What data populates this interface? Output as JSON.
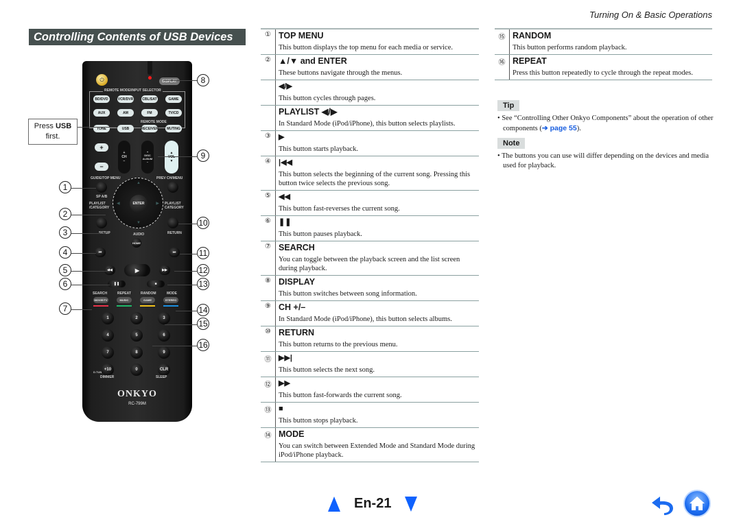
{
  "running_head": "Turning On & Basic Operations",
  "section_title": "Controlling Contents of USB Devices",
  "callout": {
    "prefix": "Press ",
    "bold": "USB",
    "suffix": "first."
  },
  "remote": {
    "brand": "ONKYO",
    "model": "RC-799M",
    "labels": {
      "display": "DISPLAY",
      "selector_group": "REMOTE MODE/INPUT SELECTOR",
      "remote_mode": "REMOTE MODE",
      "guide": "GUIDE/TOP MENU",
      "prev": "PREV CH/MENU",
      "sp": "SP A/B",
      "playlist_l": "PLAYLIST /CATEGORY",
      "playlist_r": "PLAYLIST CATEGORY",
      "setup": "SETUP",
      "return": "RETURN",
      "audio": "AUDIO",
      "home": "HOME",
      "ch": "CH",
      "disc": "DISC",
      "album": "ALBUM",
      "vol": "VOL",
      "enter": "ENTER",
      "search": "SEARCH",
      "repeat": "REPEAT",
      "random": "RANDOM",
      "mode": "MODE",
      "dtun": "D.TUN",
      "dimmer": "DIMMER",
      "sleep": "SLEEP"
    },
    "input_buttons": [
      "BD/DVD",
      "VCR/DVR",
      "CBL/SAT",
      "GAME",
      "AUX",
      "AM",
      "FM",
      "TV/CD",
      "TONE",
      "USB",
      "RECEIVER",
      "MUTING"
    ],
    "mode_buttons": [
      "MOVIE/TV",
      "MUSIC",
      "GAME",
      "STEREO"
    ],
    "mode_colors": [
      "#e8334a",
      "#1fb86a",
      "#f2c21b",
      "#1b8fe0"
    ],
    "number_buttons": [
      "1",
      "2",
      "3",
      "4",
      "5",
      "6",
      "7",
      "8",
      "9",
      "+10",
      "0",
      "CLR"
    ],
    "transport": {
      "prev": "⏮",
      "next": "⏭",
      "rew": "◀◀",
      "play": "▶",
      "ff": "▶▶",
      "pause": "❚❚",
      "stop": "■"
    }
  },
  "callout_numbers": [
    "①",
    "②",
    "③",
    "④",
    "⑤",
    "⑥",
    "⑦",
    "⑧",
    "⑨",
    "⑩",
    "⑪",
    "⑫",
    "⑬",
    "⑭",
    "⑮",
    "⑯"
  ],
  "middle_table": [
    {
      "num": "①",
      "head": "TOP MENU",
      "desc": "This button displays the top menu for each media or service."
    },
    {
      "num": "②",
      "head": "▲/▼ and ENTER",
      "desc": "These buttons navigate through the menus."
    },
    {
      "num": "",
      "head": "◀/▶",
      "desc": "This button cycles through pages.",
      "sub": true
    },
    {
      "num": "",
      "head": "PLAYLIST ◀/▶",
      "desc": "In Standard Mode (iPod/iPhone), this button selects playlists."
    },
    {
      "num": "③",
      "head": "▶",
      "desc": "This button starts playback.",
      "sub": true
    },
    {
      "num": "④",
      "head": "|◀◀",
      "desc": "This button selects the beginning of the current song. Pressing this button twice selects the previous song.",
      "sub": true
    },
    {
      "num": "⑤",
      "head": "◀◀",
      "desc": "This button fast-reverses the current song.",
      "sub": true
    },
    {
      "num": "⑥",
      "head": "❚❚",
      "desc": "This button pauses playback.",
      "sub": true
    },
    {
      "num": "⑦",
      "head": "SEARCH",
      "desc": "You can toggle between the playback screen and the list screen during playback."
    },
    {
      "num": "⑧",
      "head": "DISPLAY",
      "desc": "This button switches between song information."
    },
    {
      "num": "⑨",
      "head": "CH +/–",
      "desc": "In Standard Mode (iPod/iPhone), this button selects albums."
    },
    {
      "num": "⑩",
      "head": "RETURN",
      "desc": "This button returns to the previous menu."
    },
    {
      "num": "⑪",
      "head": "▶▶|",
      "desc": "This button selects the next song.",
      "sub": true
    },
    {
      "num": "⑫",
      "head": "▶▶",
      "desc": "This button fast-forwards the current song.",
      "sub": true
    },
    {
      "num": "⑬",
      "head": "■",
      "desc": "This button stops playback.",
      "sub": true
    },
    {
      "num": "⑭",
      "head": "MODE",
      "desc": "You can switch between Extended Mode and Standard Mode during iPod/iPhone playback."
    }
  ],
  "right_table": [
    {
      "num": "⑮",
      "head": "RANDOM",
      "desc": "This button performs random playback."
    },
    {
      "num": "⑯",
      "head": "REPEAT",
      "desc": "Press this button repeatedly to cycle through the repeat modes."
    }
  ],
  "tip": {
    "label": "Tip",
    "text_before": "See “Controlling Other Onkyo Components” about the operation of other components (",
    "link": "➔ page 55",
    "text_after": ")."
  },
  "note": {
    "label": "Note",
    "text": "The buttons you can use will differ depending on the devices and media used for playback."
  },
  "footer": {
    "page": "En-21",
    "prev_icon": "triangle-up",
    "next_icon": "triangle-down",
    "back_icon": "back-arrow",
    "home_icon": "home"
  },
  "colors": {
    "title_bg": "#46504f",
    "nav_blue": "#0f62fe",
    "link_blue": "#1a5fe0"
  }
}
